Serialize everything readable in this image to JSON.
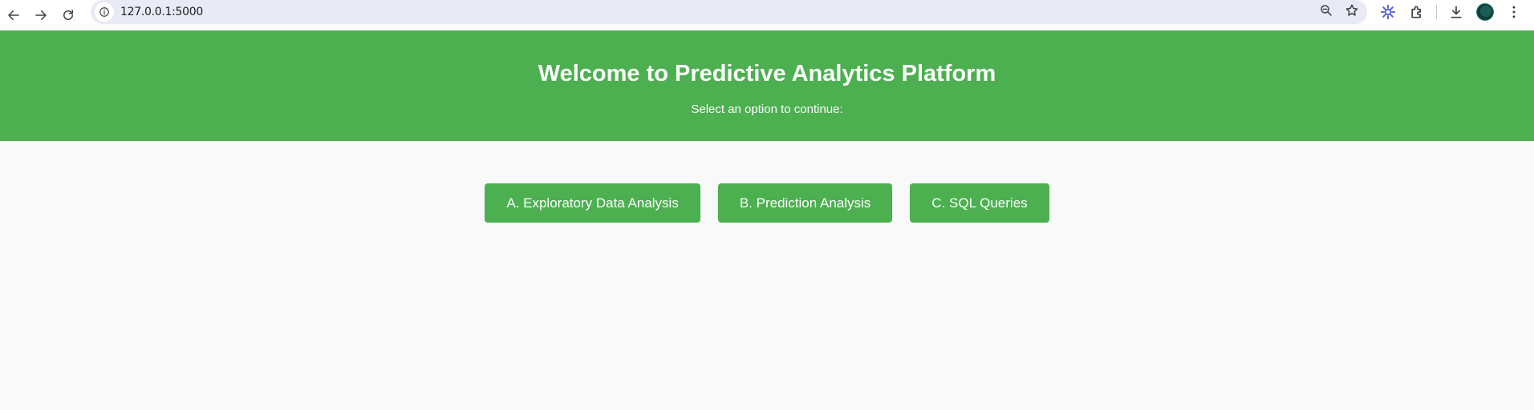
{
  "browser": {
    "url": "127.0.0.1:5000",
    "icons": [
      "back-icon",
      "forward-icon",
      "reload-icon",
      "site-info-icon",
      "zoom-icon",
      "bookmark-star-icon",
      "extension-gear-icon",
      "extensions-puzzle-icon",
      "download-icon",
      "profile-avatar",
      "menu-kebab-icon"
    ]
  },
  "header": {
    "title": "Welcome to Predictive Analytics Platform",
    "subtitle": "Select an option to continue:"
  },
  "options": {
    "eda": "A. Exploratory Data Analysis",
    "prediction": "B. Prediction Analysis",
    "sql": "C. SQL Queries"
  },
  "colors": {
    "brand_green": "#4caf50",
    "page_background": "#f9f9f9",
    "omnibox_background": "#e8eaf5"
  }
}
